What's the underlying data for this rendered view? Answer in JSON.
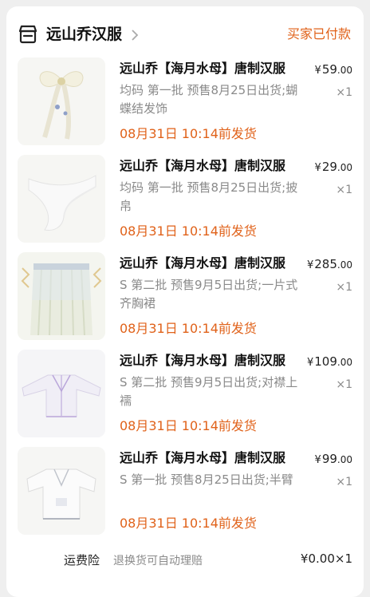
{
  "shop": {
    "name": "远山乔汉服",
    "status": "买家已付款"
  },
  "items": [
    {
      "title": "远山乔【海月水母】唐制汉服",
      "spec": "均码 第一批 预售8月25日出货;蝴蝶结发饰",
      "ship": "08月31日 10:14前发货",
      "currency": "¥",
      "price_int": "59",
      "price_dec": ".00",
      "qty": "×1",
      "thumb_icon": "bow-hair-accessory-image"
    },
    {
      "title": "远山乔【海月水母】唐制汉服",
      "spec": "均码 第一批 预售8月25日出货;披帛",
      "ship": "08月31日 10:14前发货",
      "currency": "¥",
      "price_int": "29",
      "price_dec": ".00",
      "qty": "×1",
      "thumb_icon": "shawl-image"
    },
    {
      "title": "远山乔【海月水母】唐制汉服",
      "spec": "S 第二批 预售9月5日出货;一片式齐胸裙",
      "ship": "08月31日 10:14前发货",
      "currency": "¥",
      "price_int": "285",
      "price_dec": ".00",
      "qty": "×1",
      "thumb_icon": "skirt-image"
    },
    {
      "title": "远山乔【海月水母】唐制汉服",
      "spec": "S 第二批 预售9月5日出货;对襟上襦",
      "ship": "08月31日 10:14前发货",
      "currency": "¥",
      "price_int": "109",
      "price_dec": ".00",
      "qty": "×1",
      "thumb_icon": "top-garment-image"
    },
    {
      "title": "远山乔【海月水母】唐制汉服",
      "spec": "S 第一批 预售8月25日出货;半臂",
      "ship": "08月31日 10:14前发货",
      "currency": "¥",
      "price_int": "99",
      "price_dec": ".00",
      "qty": "×1",
      "thumb_icon": "half-sleeve-image"
    }
  ],
  "insurance": {
    "label": "运费险",
    "desc": "退换货可自动理赔",
    "price": "¥0.00",
    "qty": "×1"
  },
  "colors": {
    "accent": "#e0621a",
    "muted": "#8a8a8a",
    "background": "#efefef"
  }
}
